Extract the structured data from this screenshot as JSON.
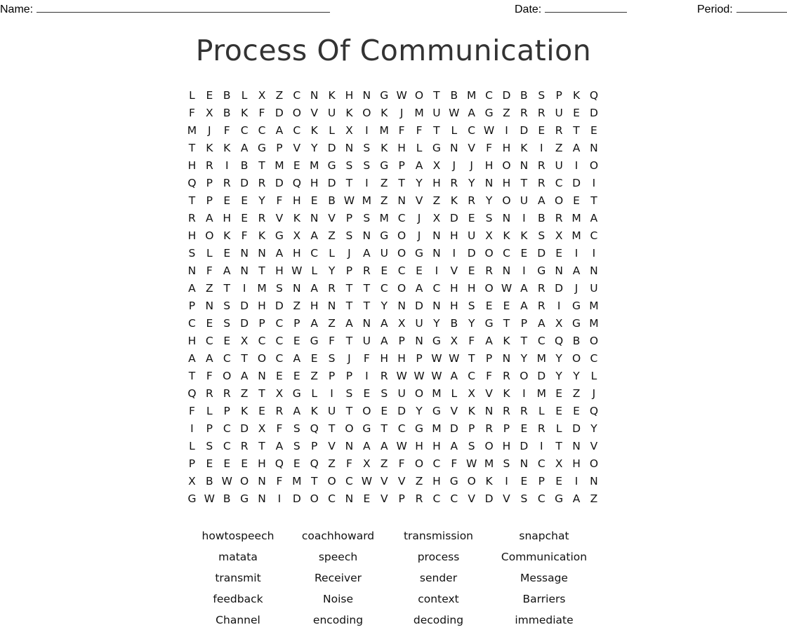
{
  "header": {
    "name_label": "Name:",
    "date_label": "Date:",
    "period_label": "Period:"
  },
  "title": "Process Of Communication",
  "grid": {
    "rows": [
      "LEBLXZCNKHNGWOTBMCDBSPKQ",
      "FXBKFDOVUKOKJMUWAGZRRUED",
      "MJFCCACKLXIMFFTLCWIDERTE",
      "TKKAGPVYDNSKHLGNVFHKIZAN",
      "HRIBTMEMGSSGPAXJJHONRUIO",
      "QPRDRDQHDTIZTYHRYNHTRCDI",
      "TPEEYFHEBWMZNVZKRYOUAOET",
      "RAHERVKNVPSMCJXDESNIBRMA",
      "HOKFKGXAZSNGOJNHUXKKSXMC",
      "SLENNAHCLJAUOGNIDOCEDEII",
      "NFANTHWLYPRECEIVERNIGNAN",
      "AZTIMSNARTTCOACHHOWARDJU",
      "PNSDHDZHNTTYNDNHSEEARIGM",
      "CESDPCPAZANAXUYBYGTPAXGM",
      "HCEXCCEGFTUAPNGXFAKTCQBO",
      "AACTOCAESJFHHPWWTPNYMYOC",
      "TFOANEEZPPIRWWWACFRODYYL",
      "QRRZTXGLISESUOMLXVKIMEZJ",
      "FLPKERAKUTOEDYGVKNRRLEEQ",
      "IPCDXFSQTOGTCGMDPRPERLDY",
      "LSCRTASPVNAAWHHASOHDITNV",
      "PEEEHQEQZFXZFOCFWMSNCXHO",
      "XBWONFMTOCWVVZHGOKIEPEIN",
      "GWBGNIDOCNEVPRCCVDVSCGAZ"
    ]
  },
  "word_list": [
    "howtospeech",
    "coachhoward",
    "transmission",
    "snapchat",
    "matata",
    "speech",
    "process",
    "Communication",
    "transmit",
    "Receiver",
    "sender",
    "Message",
    "feedback",
    "Noise",
    "context",
    "Barriers",
    "Channel",
    "encoding",
    "decoding",
    "immediate"
  ]
}
